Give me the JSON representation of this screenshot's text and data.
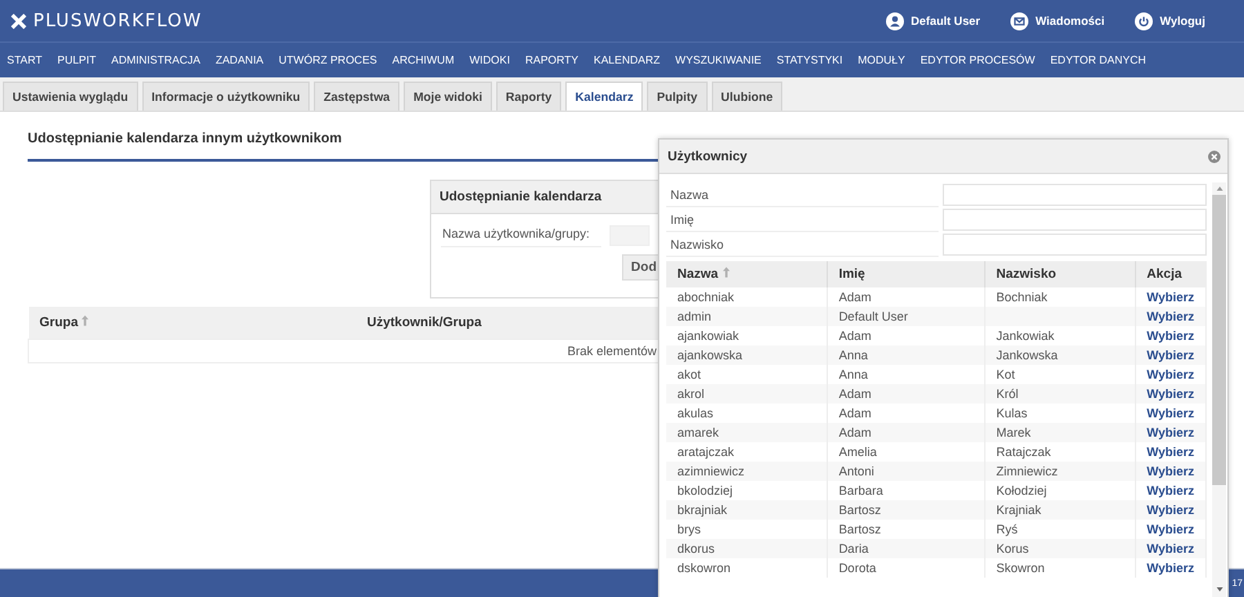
{
  "header": {
    "logo": "PLUSWORKFLOW",
    "links": [
      {
        "kind": "user",
        "label": "Default User"
      },
      {
        "kind": "mail",
        "label": "Wiadomości"
      },
      {
        "kind": "power",
        "label": "Wyloguj"
      }
    ]
  },
  "nav": [
    "START",
    "PULPIT",
    "ADMINISTRACJA",
    "ZADANIA",
    "UTWÓRZ PROCES",
    "ARCHIWUM",
    "WIDOKI",
    "RAPORTY",
    "KALENDARZ",
    "WYSZUKIWANIE",
    "STATYSTYKI",
    "MODUŁY",
    "EDYTOR PROCESÓW",
    "EDYTOR DANYCH"
  ],
  "tabs": [
    {
      "label": "Ustawienia wyglądu",
      "selected": false
    },
    {
      "label": "Informacje o użytkowniku",
      "selected": false
    },
    {
      "label": "Zastępstwa",
      "selected": false
    },
    {
      "label": "Moje widoki",
      "selected": false
    },
    {
      "label": "Raporty",
      "selected": false
    },
    {
      "label": "Kalendarz",
      "selected": true
    },
    {
      "label": "Pulpity",
      "selected": false
    },
    {
      "label": "Ulubione",
      "selected": false
    }
  ],
  "page_title": "Udostępnianie kalendarza innym użytkownikom",
  "share_panel": {
    "title": "Udostępnianie kalendarza",
    "field_label": "Nazwa użytkownika/grupy:",
    "button": "Dod"
  },
  "shares_table": {
    "columns": [
      {
        "label": "Grupa",
        "sorted": true
      },
      {
        "label": "Użytkownik/Grupa",
        "sorted": false
      }
    ],
    "empty_text": "Brak elementów"
  },
  "users_dialog": {
    "title": "Użytkownicy",
    "filters": [
      {
        "label": "Nazwa"
      },
      {
        "label": "Imię"
      },
      {
        "label": "Nazwisko"
      }
    ],
    "columns": [
      {
        "label": "Nazwa",
        "sorted": true
      },
      {
        "label": "Imię",
        "sorted": false
      },
      {
        "label": "Nazwisko",
        "sorted": false
      },
      {
        "label": "Akcja",
        "sorted": false
      }
    ],
    "rows": [
      {
        "login": "abochniak",
        "first_name": "Adam",
        "last_name": "Bochniak",
        "action": "Wybierz"
      },
      {
        "login": "admin",
        "first_name": "Default User",
        "last_name": "",
        "action": "Wybierz"
      },
      {
        "login": "ajankowiak",
        "first_name": "Adam",
        "last_name": "Jankowiak",
        "action": "Wybierz"
      },
      {
        "login": "ajankowska",
        "first_name": "Anna",
        "last_name": "Jankowska",
        "action": "Wybierz"
      },
      {
        "login": "akot",
        "first_name": "Anna",
        "last_name": "Kot",
        "action": "Wybierz"
      },
      {
        "login": "akrol",
        "first_name": "Adam",
        "last_name": "Król",
        "action": "Wybierz"
      },
      {
        "login": "akulas",
        "first_name": "Adam",
        "last_name": "Kulas",
        "action": "Wybierz"
      },
      {
        "login": "amarek",
        "first_name": "Adam",
        "last_name": "Marek",
        "action": "Wybierz"
      },
      {
        "login": "aratajczak",
        "first_name": "Amelia",
        "last_name": "Ratajczak",
        "action": "Wybierz"
      },
      {
        "login": "azimniewicz",
        "first_name": "Antoni",
        "last_name": "Zimniewicz",
        "action": "Wybierz"
      },
      {
        "login": "bkolodziej",
        "first_name": "Barbara",
        "last_name": "Kołodziej",
        "action": "Wybierz"
      },
      {
        "login": "bkrajniak",
        "first_name": "Bartosz",
        "last_name": "Krajniak",
        "action": "Wybierz"
      },
      {
        "login": "brys",
        "first_name": "Bartosz",
        "last_name": "Ryś",
        "action": "Wybierz"
      },
      {
        "login": "dkorus",
        "first_name": "Daria",
        "last_name": "Korus",
        "action": "Wybierz"
      },
      {
        "login": "dskowron",
        "first_name": "Dorota",
        "last_name": "Skowron",
        "action": "Wybierz"
      }
    ]
  },
  "footer": {
    "text": "17"
  }
}
